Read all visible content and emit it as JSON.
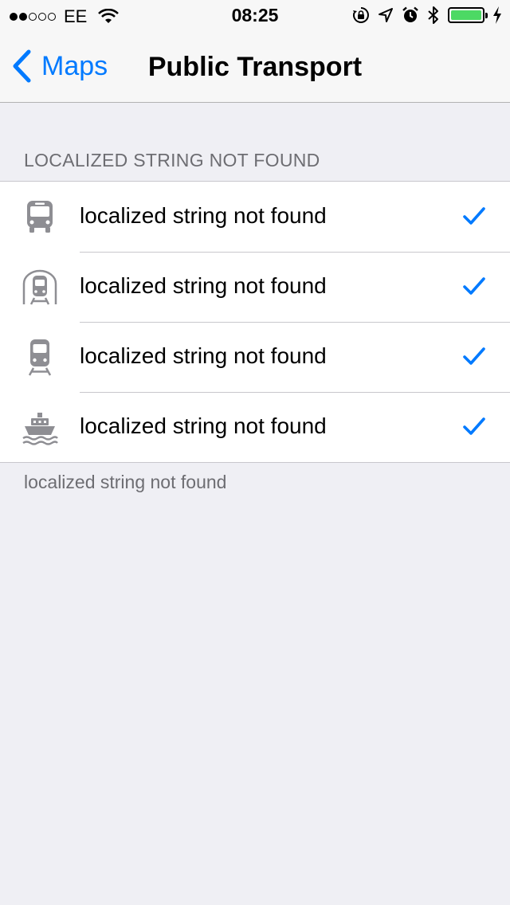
{
  "status_bar": {
    "carrier": "EE",
    "time": "08:25",
    "signal_dots": [
      true,
      true,
      false,
      false,
      false
    ],
    "icons": [
      "wifi-icon",
      "rotation-lock-icon",
      "location-arrow-icon",
      "alarm-icon",
      "bluetooth-icon",
      "battery-icon",
      "charging-bolt-icon"
    ],
    "battery_level": 1.0,
    "battery_color": "#4cd964"
  },
  "nav": {
    "back_label": "Maps",
    "title": "Public Transport",
    "accent": "#007aff"
  },
  "section": {
    "header": "LOCALIZED STRING NOT FOUND",
    "footer": "localized string not found",
    "rows": [
      {
        "icon": "bus-icon",
        "label": "localized string not found",
        "checked": true
      },
      {
        "icon": "subway-icon",
        "label": "localized string not found",
        "checked": true
      },
      {
        "icon": "train-icon",
        "label": "localized string not found",
        "checked": true
      },
      {
        "icon": "ferry-icon",
        "label": "localized string not found",
        "checked": true
      }
    ]
  }
}
